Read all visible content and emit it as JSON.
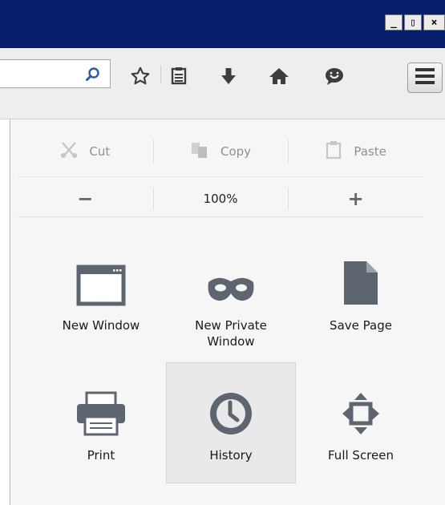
{
  "window": {
    "minimize_glyph": "_",
    "restore_glyph": "▯",
    "close_glyph": "×"
  },
  "toolbar": {
    "icons": [
      "search-icon",
      "bookmark-star-icon",
      "reading-list-icon",
      "downloads-icon",
      "home-icon",
      "chat-icon",
      "hamburger-menu-icon"
    ]
  },
  "edit": {
    "cut": "Cut",
    "copy": "Copy",
    "paste": "Paste"
  },
  "zoom": {
    "minus": "−",
    "level": "100%",
    "plus": "+"
  },
  "tiles": [
    {
      "label": "New Window",
      "icon": "window-icon"
    },
    {
      "label": "New Private\nWindow",
      "icon": "mask-icon"
    },
    {
      "label": "Save Page",
      "icon": "page-icon"
    },
    {
      "label": "Print",
      "icon": "printer-icon"
    },
    {
      "label": "History",
      "icon": "clock-icon",
      "active": true
    },
    {
      "label": "Full Screen",
      "icon": "fullscreen-icon"
    }
  ],
  "colors": {
    "titlebar": "#061f6a",
    "icon_gray": "#5d6670",
    "active_tile": "#e9e9e9"
  }
}
